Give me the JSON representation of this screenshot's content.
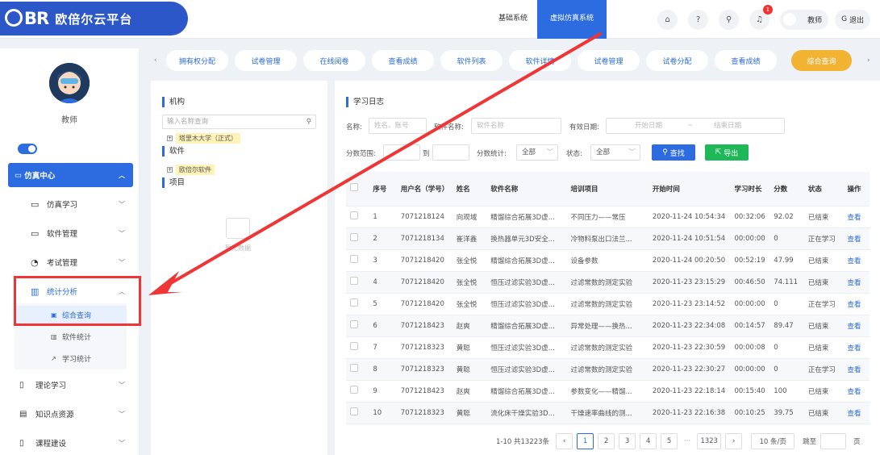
{
  "header": {
    "logo_mark": "BR",
    "logo_text": "欧倍尔云平台",
    "nav": [
      "基础系统",
      "虚拟仿真系统"
    ],
    "notification_count": "1",
    "user": "教师",
    "logout": "退出"
  },
  "sidebar": {
    "role": "教师",
    "main": "仿真中心",
    "subs": [
      "仿真学习",
      "软件管理",
      "考试管理",
      "统计分析"
    ],
    "stats_children": [
      "综合查询",
      "软件统计",
      "学习统计"
    ],
    "others": [
      "理论学习",
      "知识点资源",
      "课程建设"
    ]
  },
  "tabs": [
    "拥有权分配",
    "试卷管理",
    "在线阅卷",
    "查看成绩",
    "软件列表",
    "软件详情",
    "试卷管理",
    "试卷分配",
    "查看成绩",
    "综合查询"
  ],
  "org": {
    "title": "机构",
    "search_placeholder": "输入名称查询",
    "tree_org": "塔里木大学（正式）",
    "software_title": "软件",
    "tree_software": "欧倍尔软件",
    "project_title": "项目",
    "empty_text": "暂无数据"
  },
  "log": {
    "title": "学习日志",
    "filters": {
      "name_label": "名称:",
      "name_placeholder": "姓名、账号",
      "software_label": "软件名称:",
      "software_placeholder": "软件名称",
      "date_label": "有效日期:",
      "date_start": "开始日期",
      "date_sep": "~",
      "date_end": "结束日期",
      "score_label": "分数范围:",
      "score_to": "到",
      "score_stat_label": "分数统计:",
      "score_stat_value": "全部",
      "status_label": "状态:",
      "status_value": "全部",
      "search_btn": "查找",
      "export_btn": "导出"
    },
    "columns": [
      "序号",
      "用户名（学号）",
      "姓名",
      "软件名称",
      "培训项目",
      "开始时间",
      "学习时长",
      "分数",
      "状态",
      "操作"
    ],
    "rows": [
      [
        "1",
        "7071218124",
        "向观域",
        "精馏综合拓展3D虚...",
        "不同压力——常压",
        "2020-11-24 10:54:34",
        "00:32:06",
        "92.02",
        "已结束",
        "查看"
      ],
      [
        "2",
        "7071218134",
        "崔洋鑫",
        "换热器单元3D安全...",
        "冷物料泵出口法兰...",
        "2020-11-24 10:51:54",
        "00:00:00",
        "0",
        "正在学习",
        "查看"
      ],
      [
        "3",
        "7071218420",
        "张全悦",
        "精馏综合拓展3D虚...",
        "设备参数",
        "2020-11-24 00:20:50",
        "00:52:19",
        "47.99",
        "已结束",
        "查看"
      ],
      [
        "4",
        "7071218420",
        "张全悦",
        "恒压过滤实验3D虚...",
        "过滤常数的测定实验",
        "2020-11-23 23:15:29",
        "00:46:50",
        "74.111",
        "已结束",
        "查看"
      ],
      [
        "5",
        "7071218420",
        "张全悦",
        "恒压过滤实验3D虚...",
        "过滤常数的测定实验",
        "2020-11-23 23:14:52",
        "00:00:00",
        "0",
        "正在学习",
        "查看"
      ],
      [
        "6",
        "7071218423",
        "赵爽",
        "精馏综合拓展3D虚...",
        "异常处理——换热...",
        "2020-11-23 22:34:08",
        "00:14:57",
        "89.47",
        "已结束",
        "查看"
      ],
      [
        "7",
        "7071218323",
        "黄聪",
        "恒压过滤实验3D虚...",
        "过滤常数的测定实验",
        "2020-11-23 22:30:59",
        "00:00:08",
        "0",
        "已结束",
        "查看"
      ],
      [
        "8",
        "7071218323",
        "黄聪",
        "恒压过滤实验3D虚...",
        "过滤常数的测定实验",
        "2020-11-23 22:30:27",
        "00:00:00",
        "0",
        "正在学习",
        "查看"
      ],
      [
        "9",
        "7071218423",
        "赵爽",
        "精馏综合拓展3D虚...",
        "参数变化——精馏...",
        "2020-11-23 22:18:14",
        "00:15:40",
        "100",
        "已结束",
        "查看"
      ],
      [
        "10",
        "7071218323",
        "黄聪",
        "流化床干燥实验3D...",
        "干燥速率曲线的测...",
        "2020-11-23 22:16:38",
        "00:10:25",
        "39.75",
        "已结束",
        "查看"
      ]
    ],
    "pager": {
      "summary": "1-10 共13223条",
      "pages": [
        "1",
        "2",
        "3",
        "4",
        "5"
      ],
      "ellipsis": "···",
      "last": "1323",
      "page_size": "10 条/页",
      "jump_label": "跳至",
      "page_unit": "页"
    }
  },
  "colors": {
    "primary": "#2c6ce0",
    "accent": "#f2b332",
    "annotation": "#ef3535",
    "success": "#1fb859"
  }
}
